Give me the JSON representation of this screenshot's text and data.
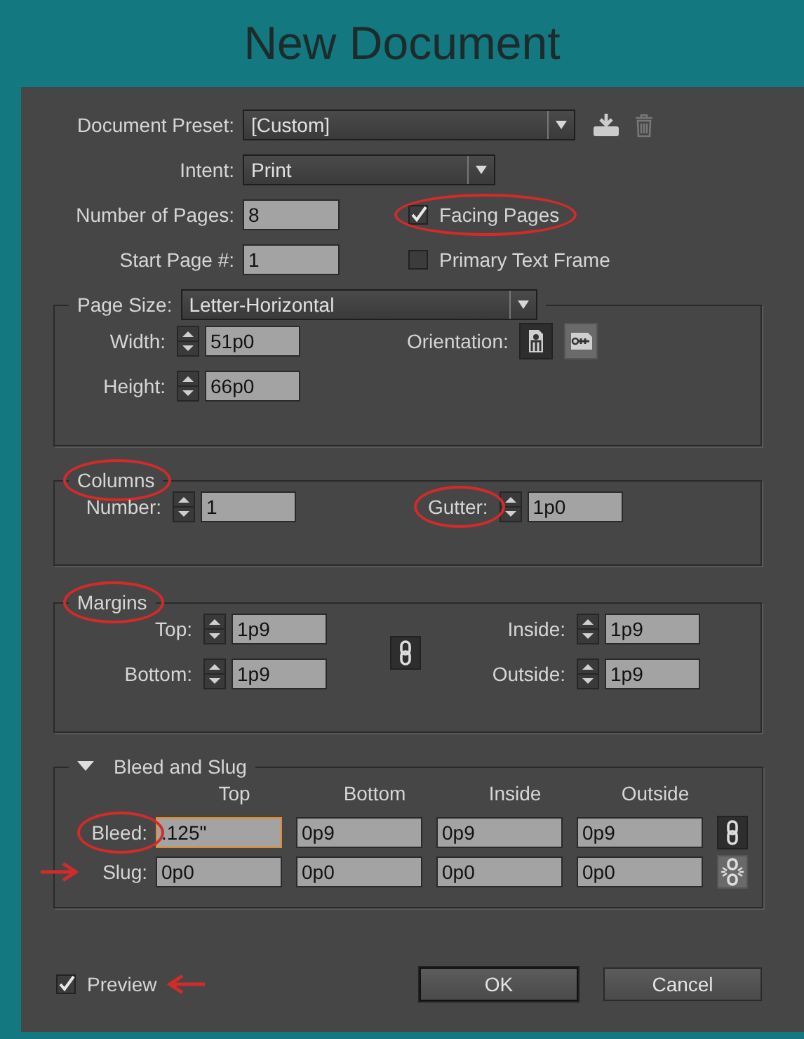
{
  "window": {
    "title": "New Document"
  },
  "preset": {
    "label": "Document Preset:",
    "value": "[Custom]"
  },
  "intent": {
    "label": "Intent:",
    "value": "Print"
  },
  "pages": {
    "label": "Number of Pages:",
    "value": "8"
  },
  "start_page": {
    "label": "Start Page #:",
    "value": "1"
  },
  "options": [
    {
      "label": "Facing Pages",
      "checked": true,
      "circled": true
    },
    {
      "label": "Primary Text Frame",
      "checked": false,
      "circled": false
    }
  ],
  "page_size": {
    "label": "Page Size:",
    "value": "Letter-Horizontal",
    "width": {
      "label": "Width:",
      "value": "51p0"
    },
    "height": {
      "label": "Height:",
      "value": "66p0"
    },
    "orientation": {
      "label": "Orientation:",
      "options": [
        {
          "kind": "portrait",
          "selected": true
        },
        {
          "kind": "landscape",
          "selected": false
        }
      ]
    }
  },
  "columns": {
    "title": "Columns",
    "circled": true,
    "number": {
      "label": "Number:",
      "value": "1"
    },
    "gutter": {
      "label": "Gutter:",
      "value": "1p0",
      "circled": true
    }
  },
  "margins": {
    "title": "Margins",
    "circled": true,
    "linked": true,
    "fields": [
      {
        "label": "Top:",
        "value": "1p9"
      },
      {
        "label": "Inside:",
        "value": "1p9"
      },
      {
        "label": "Bottom:",
        "value": "1p9"
      },
      {
        "label": "Outside:",
        "value": "1p9"
      }
    ]
  },
  "bleed_slug": {
    "title": "Bleed and Slug",
    "expanded": true,
    "columns": [
      "Top",
      "Bottom",
      "Inside",
      "Outside"
    ],
    "rows": [
      {
        "label": "Bleed:",
        "circled": true,
        "arrow": false,
        "linked": true,
        "values": [
          {
            "value": ".125\"",
            "focused": true
          },
          {
            "value": "0p9",
            "focused": false
          },
          {
            "value": "0p9",
            "focused": false
          },
          {
            "value": "0p9",
            "focused": false
          }
        ]
      },
      {
        "label": "Slug:",
        "circled": false,
        "arrow": true,
        "linked": false,
        "values": [
          {
            "value": "0p0",
            "focused": false
          },
          {
            "value": "0p0",
            "focused": false
          },
          {
            "value": "0p0",
            "focused": false
          },
          {
            "value": "0p0",
            "focused": false
          }
        ]
      }
    ]
  },
  "preview": {
    "label": "Preview",
    "checked": true,
    "arrow": true
  },
  "buttons": [
    {
      "label": "OK",
      "default": true
    },
    {
      "label": "Cancel",
      "default": false
    }
  ]
}
